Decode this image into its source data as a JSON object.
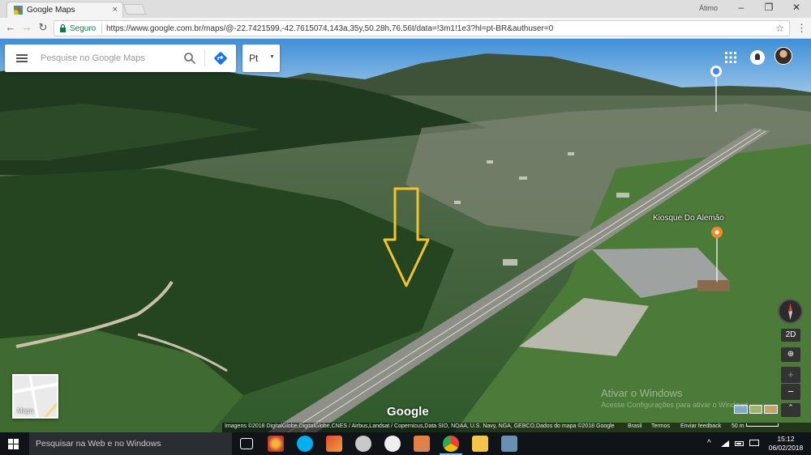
{
  "browser": {
    "tab_title": "Google Maps",
    "tab_close": "×",
    "window_user": "Átimo",
    "window_controls": [
      "–",
      "❐",
      "✕"
    ],
    "security_label": "Seguro",
    "url": "https://www.google.com.br/maps/@-22.7421599,-42.7615074,143a,35y,50.28h,76.56t/data=!3m1!1e3?hl=pt-BR&authuser=0",
    "nav": {
      "back": "←",
      "forward": "→",
      "reload": "↻"
    },
    "star": "☆",
    "menu": "⋮"
  },
  "maps": {
    "search_placeholder": "Pesquise no Google Maps",
    "language": "Pt",
    "language_caret": "▼",
    "poi_label": "Kiosque Do Alemão",
    "mini_map_label": "Mapa",
    "logo": "Google",
    "view_2d": "2D",
    "zoom_in": "+",
    "zoom_out": "−",
    "tilt": "⊕",
    "expand": "⌃",
    "attribution": {
      "imagery": "Imagens ©2018 DigitalGlobe,DigitalGlobe,CNES / Airbus,Landsat / Copernicus,Data SIO, NOAA, U.S. Navy, NGA, GEBCO,Dados do mapa ©2018 Google",
      "country": "Brasil",
      "terms": "Termos",
      "feedback": "Enviar feedback",
      "scale": "50 m"
    }
  },
  "windows": {
    "watermark_title": "Ativar o Windows",
    "watermark_subtitle": "Acesse Configurações para ativar o Windows.",
    "taskbar_search": "Pesquisar na Web e no Windows",
    "time": "15:12",
    "date": "06/02/2018",
    "tray_caret": "^"
  },
  "colors": {
    "secure_green": "#0b8043",
    "arrow_yellow": "#f2c230",
    "pin_orange": "#f08a24",
    "taskbar": "#101418"
  }
}
